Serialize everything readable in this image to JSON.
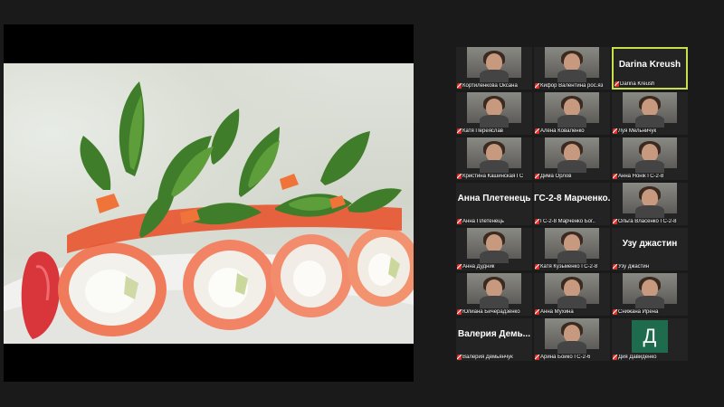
{
  "shared_screen": {
    "content": "sushi-rolls-photo"
  },
  "gallery": {
    "participants": [
      {
        "label": "Кортиленкова Оксана",
        "big_name": "",
        "avatar": "",
        "active": false
      },
      {
        "label": "Кифор Валентина рос.яз",
        "big_name": "",
        "avatar": "",
        "active": false
      },
      {
        "label": "Darina Kreush",
        "big_name": "Darina Kreush",
        "avatar": "",
        "active": true
      },
      {
        "label": "Катя Переяслав",
        "big_name": "",
        "avatar": "",
        "active": false
      },
      {
        "label": "Алёна Коваленко",
        "big_name": "",
        "avatar": "",
        "active": false
      },
      {
        "label": "Луя Мельничук",
        "big_name": "",
        "avatar": "",
        "active": false
      },
      {
        "label": "Кристина Кашинская ГС",
        "big_name": "",
        "avatar": "",
        "active": false
      },
      {
        "label": "Дима Орлов",
        "big_name": "",
        "avatar": "",
        "active": false
      },
      {
        "label": "Анна Нонік ГС-2-8",
        "big_name": "",
        "avatar": "",
        "active": false
      },
      {
        "label": "Анна Плетенець",
        "big_name": "Анна Плетенець",
        "avatar": "",
        "active": false
      },
      {
        "label": "ГС-2-8 Марченко Бог..",
        "big_name": "ГС-2-8 Марченко...",
        "avatar": "",
        "active": false
      },
      {
        "label": "Ольга Власенко ГС-2-8",
        "big_name": "",
        "avatar": "",
        "active": false
      },
      {
        "label": "Анна Дудник",
        "big_name": "",
        "avatar": "",
        "active": false
      },
      {
        "label": "Катя Кузьменко ГС-2-8",
        "big_name": "",
        "avatar": "",
        "active": false
      },
      {
        "label": "Узу джастин",
        "big_name": "Узу джастин",
        "avatar": "",
        "active": false
      },
      {
        "label": "Юлиана Бичерадзенко",
        "big_name": "",
        "avatar": "",
        "active": false
      },
      {
        "label": "Анна Мухина",
        "big_name": "",
        "avatar": "",
        "active": false
      },
      {
        "label": "Снижана Ирена",
        "big_name": "",
        "avatar": "",
        "active": false
      },
      {
        "label": "Валерия Демьянчук",
        "big_name": "Валерия Демь...",
        "avatar": "",
        "active": false
      },
      {
        "label": "Арина Бойко ГС-2-6",
        "big_name": "",
        "avatar": "",
        "active": false
      },
      {
        "label": "Дия Давиденко",
        "big_name": "",
        "avatar": "Д",
        "active": false
      }
    ]
  },
  "colors": {
    "background": "#1a1a1a",
    "tile": "#232323",
    "active_border": "#c9e04a",
    "muted_mic": "#e0312b",
    "avatar_bg": "#1f6b4e"
  }
}
